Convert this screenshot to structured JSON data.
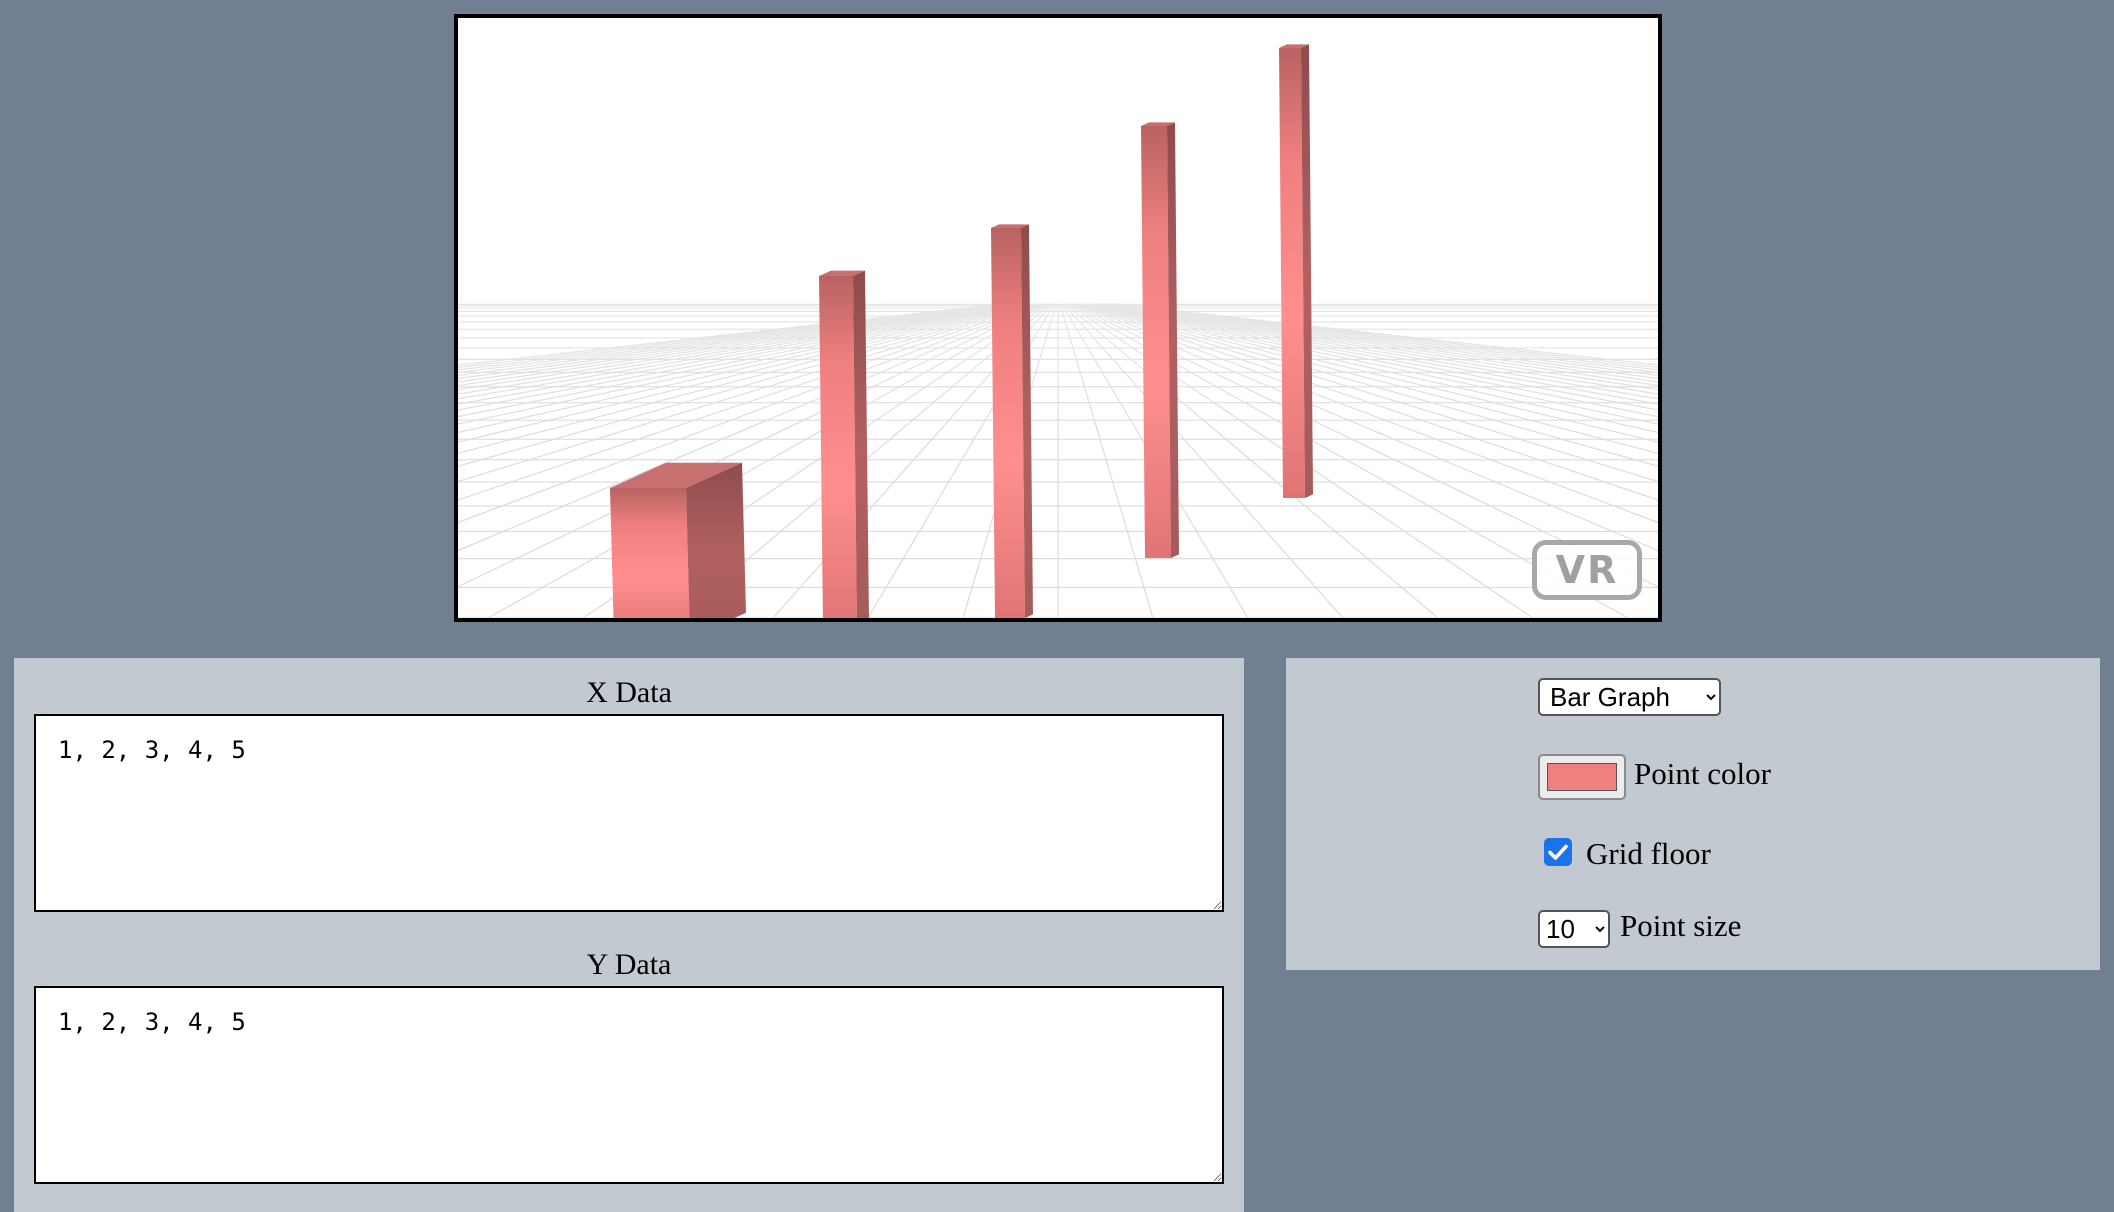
{
  "vr_button_label": "VR",
  "data_panel": {
    "x_label": "X Data",
    "x_value": "1, 2, 3, 4, 5",
    "y_label": "Y Data",
    "y_value": "1, 2, 3, 4, 5"
  },
  "options": {
    "chart_type_selected": "Bar Graph",
    "point_color_label": "Point color",
    "point_color": "#f08080",
    "grid_floor_label": "Grid floor",
    "grid_floor_checked": true,
    "point_size_selected": "10",
    "point_size_label": "Point size"
  },
  "chart_data": {
    "type": "bar",
    "categories": [
      "1",
      "2",
      "3",
      "4",
      "5"
    ],
    "values": [
      1,
      2,
      3,
      4,
      5
    ],
    "grid": true,
    "color": "#f08080"
  },
  "colors": {
    "background": "#708090",
    "panel": "#c3c9d0",
    "bar_light": "#f58a8a",
    "bar_dark": "#b05e5e",
    "checkbox_accent": "#1a73e8"
  }
}
